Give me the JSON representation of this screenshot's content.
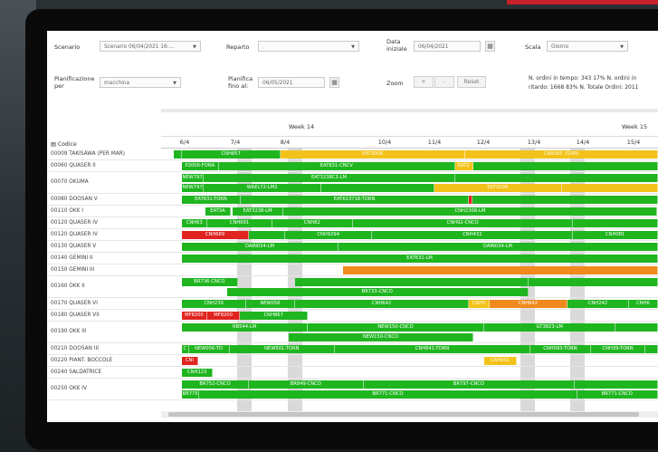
{
  "filters": {
    "scenario_label": "Scenario",
    "scenario_value": "Scenario 06/04/2021 16:...",
    "reparto_label": "Reparto",
    "reparto_value": "",
    "data_iniziale_label": "Data iniziale",
    "data_iniziale_value": "06/04/2021",
    "scala_label": "Scala",
    "scala_value": "Giorno",
    "pianificazione_label": "Pianificazione per",
    "pianificazione_value": "macchina",
    "pianifica_label": "Pianifica fino al:",
    "pianifica_value": "06/05/2021",
    "zoom_label": "Zoom",
    "zoom_plus": "+",
    "zoom_minus": "-",
    "reset_label": "Reset"
  },
  "stats": {
    "text": "N. ordini in tempo: 343 17% N. ordini in ritardo: 1668 83% N. Totale Ordini: 2011"
  },
  "header": {
    "codice_label": "Codice",
    "weeks": [
      "Week 14",
      "Week 15"
    ],
    "days": [
      "6/4",
      "7/4",
      "8/4",
      "10/4",
      "11/4",
      "12/4",
      "13/4",
      "14/4",
      "15/4"
    ]
  },
  "colors": {
    "green": "#1fb51f",
    "dark_green": "#14a014",
    "yellow": "#f2c21b",
    "orange": "#f08a1c",
    "red": "#e0241f"
  },
  "rows": [
    {
      "label": "00009 TAKISAWA (PER MAR)",
      "bars": [
        {
          "s": 0.0,
          "e": 0.017,
          "c": "green",
          "t": ""
        },
        {
          "s": 0.017,
          "e": 0.221,
          "c": "green",
          "t": "CNH857"
        },
        {
          "s": 0.221,
          "e": 0.601,
          "c": "yellow",
          "t": "EAT3008"
        },
        {
          "s": 0.601,
          "e": 1.0,
          "c": "yellow",
          "t": "CAR083 -TORN"
        }
      ]
    },
    {
      "label": "00060 QUASER II",
      "bars": [
        {
          "s": 0.017,
          "e": 0.093,
          "c": "green",
          "t": "P2006-FONA"
        },
        {
          "s": 0.093,
          "e": 0.581,
          "c": "green",
          "t": "EAT631-CNCV"
        },
        {
          "s": 0.581,
          "e": 0.618,
          "c": "yellow",
          "t": "EAT2"
        },
        {
          "s": 0.618,
          "e": 1.0,
          "c": "green",
          "t": ""
        }
      ]
    },
    {
      "label": "00070 OKUMA",
      "bars": [
        {
          "s": 0.017,
          "e": 0.062,
          "c": "green",
          "t": "NEW797"
        },
        {
          "s": 0.062,
          "e": 0.581,
          "c": "green",
          "t": "EAT3238C3-LM"
        },
        {
          "s": 0.581,
          "e": 1.0,
          "c": "green",
          "t": ""
        }
      ],
      "sub": [
        {
          "s": 0.017,
          "e": 0.062,
          "c": "green",
          "t": "NEW797"
        },
        {
          "s": 0.062,
          "e": 0.305,
          "c": "green",
          "t": "WAEL72-LM2"
        },
        {
          "s": 0.305,
          "e": 0.538,
          "c": "green",
          "t": ""
        },
        {
          "s": 0.538,
          "e": 0.801,
          "c": "yellow",
          "t": "EAT3008"
        },
        {
          "s": 0.801,
          "e": 1.0,
          "c": "yellow",
          "t": ""
        }
      ]
    },
    {
      "label": "00080 DOOSAN V",
      "bars": [
        {
          "s": 0.017,
          "e": 0.138,
          "c": "green",
          "t": "EAT631-TORN"
        },
        {
          "s": 0.138,
          "e": 0.61,
          "c": "green",
          "t": "EAT613718-TORN"
        },
        {
          "s": 0.61,
          "e": 0.617,
          "c": "red",
          "t": ""
        },
        {
          "s": 0.617,
          "e": 1.0,
          "c": "green",
          "t": ""
        }
      ]
    },
    {
      "label": "00110 OKK I",
      "bars": [
        {
          "s": 0.066,
          "e": 0.117,
          "c": "green",
          "t": "EAT3A"
        },
        {
          "s": 0.121,
          "e": 0.227,
          "c": "green",
          "t": "EAT3238-LM"
        },
        {
          "s": 0.227,
          "e": 0.999,
          "c": "green",
          "t": "CNH2308-LM"
        }
      ]
    },
    {
      "label": "00120 QUASER IV",
      "bars": [
        {
          "s": 0.017,
          "e": 0.07,
          "c": "green",
          "t": "CNH63"
        },
        {
          "s": 0.07,
          "e": 0.203,
          "c": "green",
          "t": "CNH691"
        },
        {
          "s": 0.203,
          "e": 0.37,
          "c": "green",
          "t": "CNH82"
        },
        {
          "s": 0.37,
          "e": 0.825,
          "c": "green",
          "t": "CNH92-CNCO"
        },
        {
          "s": 0.825,
          "e": 1.0,
          "c": "green",
          "t": ""
        }
      ]
    },
    {
      "label": "00120 QUASER IV",
      "bars": [
        {
          "s": 0.017,
          "e": 0.155,
          "c": "red",
          "t": "CNH689"
        },
        {
          "s": 0.155,
          "e": 0.23,
          "c": "green",
          "t": ""
        },
        {
          "s": 0.23,
          "e": 0.41,
          "c": "green",
          "t": "CNH9294"
        },
        {
          "s": 0.41,
          "e": 0.825,
          "c": "green",
          "t": "CNH432"
        },
        {
          "s": 0.825,
          "e": 1.0,
          "c": "green",
          "t": "CNH081"
        }
      ]
    },
    {
      "label": "00130 QUASER V",
      "bars": [
        {
          "s": 0.017,
          "e": 0.34,
          "c": "green",
          "t": "DAIN034-LM"
        },
        {
          "s": 0.34,
          "e": 1.0,
          "c": "green",
          "t": "DAIN034-LM"
        }
      ]
    },
    {
      "label": "00140 GEMINI II",
      "bars": [
        {
          "s": 0.017,
          "e": 1.0,
          "c": "green",
          "t": "EAT631-LM"
        }
      ]
    },
    {
      "label": "00150 GEMINI III",
      "bars": [
        {
          "s": 0.35,
          "e": 1.0,
          "c": "orange",
          "t": ""
        }
      ]
    },
    {
      "label": "00160 OKK II",
      "bars": [
        {
          "s": 0.017,
          "e": 0.132,
          "c": "green",
          "t": "BR736-CNCO"
        },
        {
          "s": 0.25,
          "e": 0.732,
          "c": "green",
          "t": ""
        },
        {
          "s": 0.732,
          "e": 1.0,
          "c": "green",
          "t": ""
        }
      ],
      "sub": [
        {
          "s": 0.11,
          "e": 0.732,
          "c": "green",
          "t": "BR733-CNCO"
        }
      ]
    },
    {
      "label": "00170 QUASER VI",
      "bars": [
        {
          "s": 0.017,
          "e": 0.15,
          "c": "green",
          "t": "CNH239"
        },
        {
          "s": 0.15,
          "e": 0.25,
          "c": "green",
          "t": "NEW056"
        },
        {
          "s": 0.25,
          "e": 0.61,
          "c": "green",
          "t": "CNH642"
        },
        {
          "s": 0.61,
          "e": 0.652,
          "c": "yellow",
          "t": "CNH3"
        },
        {
          "s": 0.652,
          "e": 0.813,
          "c": "orange",
          "t": "CNH642"
        },
        {
          "s": 0.813,
          "e": 0.94,
          "c": "green",
          "t": "CNH242"
        },
        {
          "s": 0.94,
          "e": 1.0,
          "c": "green",
          "t": "CNH6"
        }
      ]
    },
    {
      "label": "00180 QUASER VII",
      "bars": [
        {
          "s": 0.017,
          "e": 0.069,
          "c": "red",
          "t": "MF8200"
        },
        {
          "s": 0.069,
          "e": 0.137,
          "c": "red",
          "t": "MF8200"
        },
        {
          "s": 0.137,
          "e": 0.277,
          "c": "green",
          "t": "CNH867"
        }
      ]
    },
    {
      "label": "00190 OKK III",
      "bars": [
        {
          "s": 0.017,
          "e": 0.277,
          "c": "green",
          "t": "RB544-LM"
        },
        {
          "s": 0.277,
          "e": 0.641,
          "c": "green",
          "t": "NEW150-CNCO"
        },
        {
          "s": 0.641,
          "e": 0.913,
          "c": "green",
          "t": "GT3823-LM"
        },
        {
          "s": 0.913,
          "e": 1.0,
          "c": "green",
          "t": ""
        }
      ],
      "sub": [
        {
          "s": 0.237,
          "e": 0.619,
          "c": "green",
          "t": "NEW150-CNCO"
        }
      ]
    },
    {
      "label": "00210 DOOSAN III",
      "bars": [
        {
          "s": 0.017,
          "e": 0.031,
          "c": "green",
          "t": "C"
        },
        {
          "s": 0.031,
          "e": 0.115,
          "c": "green",
          "t": "NEW056-TO"
        },
        {
          "s": 0.115,
          "e": 0.333,
          "c": "green",
          "t": "NEW501-TORN"
        },
        {
          "s": 0.333,
          "e": 0.736,
          "c": "green",
          "t": "CNH641-TORN"
        },
        {
          "s": 0.736,
          "e": 0.862,
          "c": "green",
          "t": "CNH093-TORN"
        },
        {
          "s": 0.862,
          "e": 0.974,
          "c": "green",
          "t": "CNH39-TORN"
        },
        {
          "s": 0.974,
          "e": 1.0,
          "c": "green",
          "t": ""
        }
      ]
    },
    {
      "label": "00220 PIANT. BOCCOLE",
      "bars": [
        {
          "s": 0.017,
          "e": 0.05,
          "c": "red",
          "t": "CNI"
        },
        {
          "s": 0.641,
          "e": 0.709,
          "c": "yellow",
          "t": "CNH001"
        }
      ]
    },
    {
      "label": "00240 SALDATRICE",
      "bars": [
        {
          "s": 0.017,
          "e": 0.081,
          "c": "green",
          "t": "CNH123"
        }
      ]
    },
    {
      "label": "00250 OKK IV",
      "bars": [
        {
          "s": 0.017,
          "e": 0.155,
          "c": "green",
          "t": "BR752-CNCO"
        },
        {
          "s": 0.155,
          "e": 0.392,
          "c": "green",
          "t": "BR849-CNCO"
        },
        {
          "s": 0.392,
          "e": 0.828,
          "c": "green",
          "t": "BR797-CNCO"
        },
        {
          "s": 0.828,
          "e": 1.0,
          "c": "green",
          "t": ""
        }
      ],
      "sub": [
        {
          "s": 0.017,
          "e": 0.053,
          "c": "green",
          "t": "BR775"
        },
        {
          "s": 0.053,
          "e": 0.833,
          "c": "green",
          "t": "BR771-CNCO"
        },
        {
          "s": 0.833,
          "e": 1.0,
          "c": "green",
          "t": "BR771-CNCO"
        }
      ]
    }
  ]
}
